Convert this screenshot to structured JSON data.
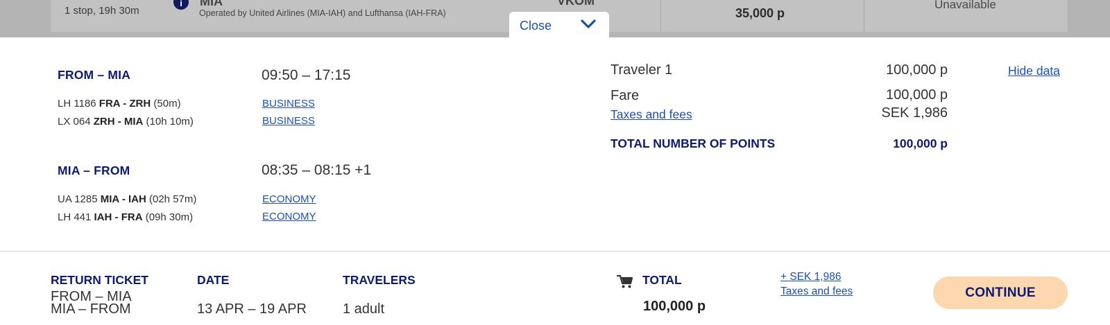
{
  "top_bar": {
    "stops": "1 stop, 19h 30m",
    "airport": "MIA",
    "operated_by": "Operated by United Airlines (MIA-IAH) and Lufthansa (IAH-FRA)",
    "class_partial": "VKOM",
    "points": "35,000 p",
    "unavailable": "Unavailable",
    "info_icon": "info-icon"
  },
  "close_tab": {
    "label": "Close",
    "icon": "chevron-down-icon"
  },
  "outbound": {
    "title": "FROM – MIA",
    "time": "09:50 – 17:15",
    "segments": [
      {
        "flight": "LH 1186",
        "route": "FRA - ZRH",
        "duration": "(50m)",
        "cabin": "BUSINESS"
      },
      {
        "flight": "LX 064",
        "route": "ZRH - MIA",
        "duration": "(10h 10m)",
        "cabin": "BUSINESS"
      }
    ]
  },
  "inbound": {
    "title": "MIA – FROM",
    "time": "08:35 – 08:15 +1",
    "segments": [
      {
        "flight": "UA 1285",
        "route": "MIA - IAH",
        "duration": "(02h 57m)",
        "cabin": "ECONOMY"
      },
      {
        "flight": "LH 441",
        "route": "IAH - FRA",
        "duration": "(09h 30m)",
        "cabin": "ECONOMY"
      }
    ]
  },
  "price": {
    "traveler_label": "Traveler 1",
    "traveler_value": "100,000 p",
    "hide_data": "Hide data",
    "fare_label": "Fare",
    "fare_value": "100,000 p",
    "taxes_label": "Taxes and fees",
    "taxes_value": "SEK 1,986",
    "total_label": "TOTAL NUMBER OF POINTS",
    "total_value": "100,000 p"
  },
  "footer": {
    "ticket_title": "RETURN TICKET",
    "ticket_line1": "FROM – MIA",
    "ticket_line2": "MIA – FROM",
    "date_title": "DATE",
    "date_value": "13 APR – 19 APR",
    "travelers_title": "TRAVELERS",
    "travelers_value": "1 adult",
    "total_title": "TOTAL",
    "total_points": "100,000 p",
    "sek_link": "+ SEK 1,986",
    "taxes_link": "Taxes and fees",
    "continue": "CONTINUE",
    "cart_icon": "cart-icon"
  },
  "colors": {
    "navy": "#0d1b6e",
    "link": "#1d4fb5",
    "button": "#fcd7b0",
    "overlay": "#b4b4b4"
  }
}
